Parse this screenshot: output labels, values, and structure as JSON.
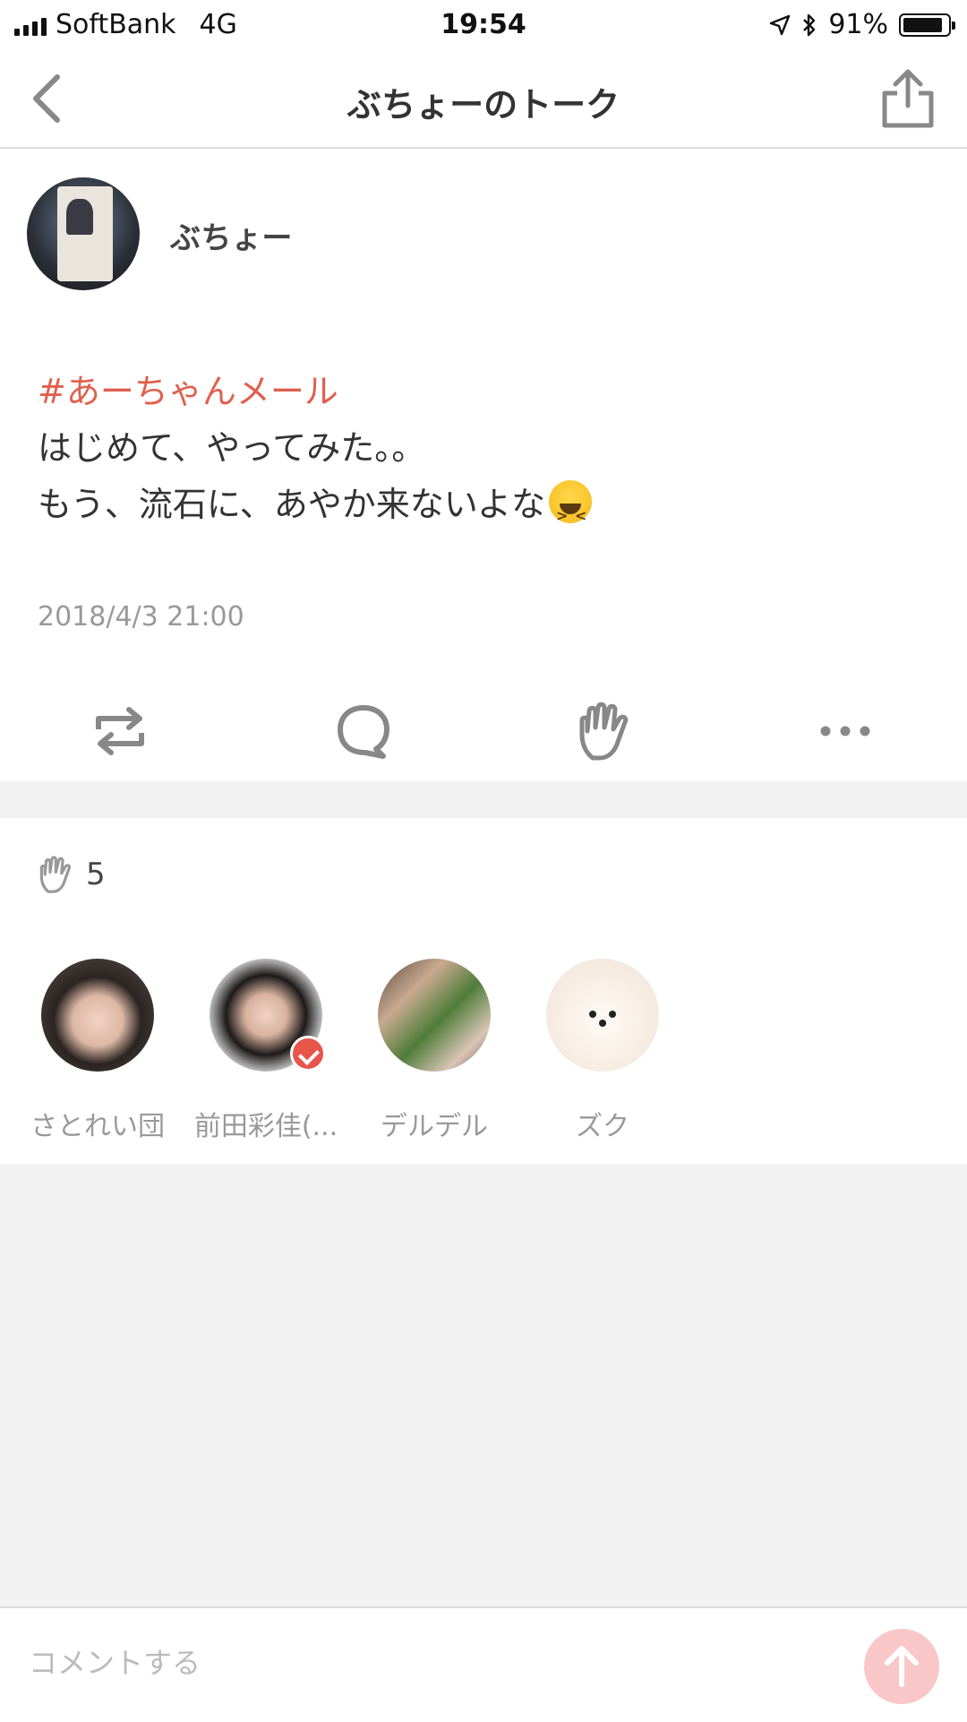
{
  "status_bar": {
    "carrier": "SoftBank",
    "network": "4G",
    "time": "19:54",
    "battery": "91%",
    "battery_level": 0.91
  },
  "nav": {
    "title": "ぶちょーのトーク",
    "back_icon": "chevron-left-icon",
    "share_icon": "share-icon"
  },
  "post": {
    "author": "ぶちょー",
    "hashtag": "#あーちゃんメール",
    "line1": "はじめて、やってみた。。",
    "line2": "もう、流石に、あやか来ないよな",
    "emoji": "😆",
    "timestamp": "2018/4/3 21:00"
  },
  "actions": [
    {
      "icon": "repost-icon"
    },
    {
      "icon": "comment-icon"
    },
    {
      "icon": "clap-icon"
    },
    {
      "icon": "more-icon"
    }
  ],
  "likes": {
    "count": "5",
    "users": [
      {
        "name": "さとれい団"
      },
      {
        "name": "前田彩佳(..."
      },
      {
        "name": "デルデル"
      },
      {
        "name": "ズク"
      }
    ]
  },
  "comment": {
    "placeholder": "コメントする"
  },
  "colors": {
    "hashtag": "#e0604e",
    "send_button": "#f9c7c7",
    "divider_bg": "#f2f2f2"
  }
}
